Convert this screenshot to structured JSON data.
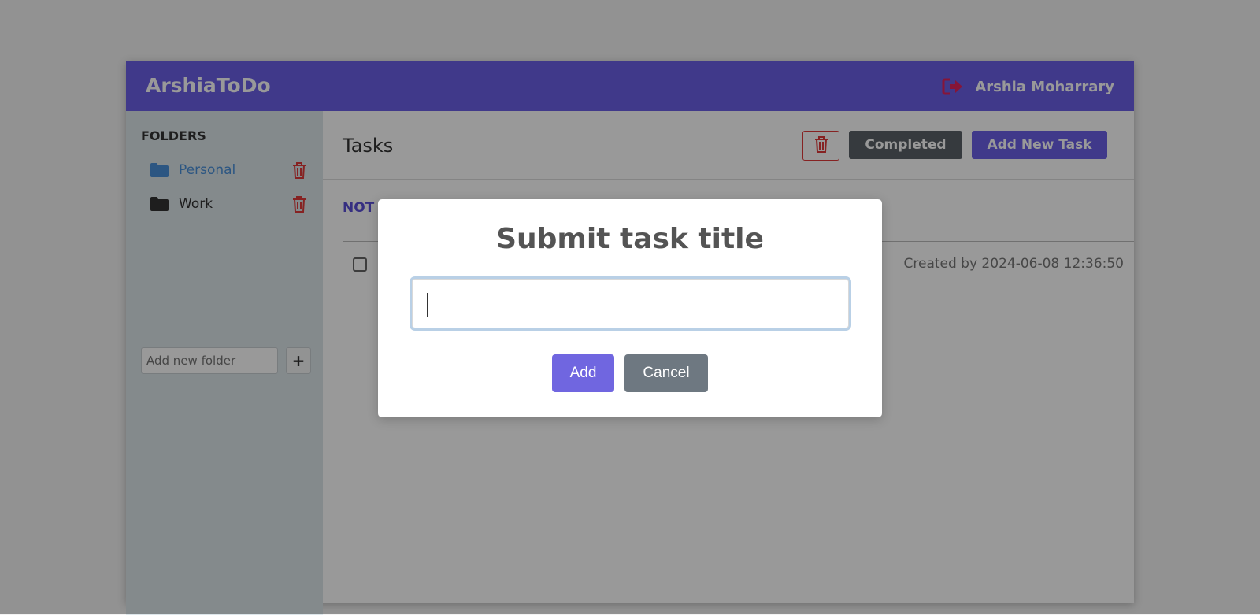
{
  "app": {
    "brand": "ArshiaToDo",
    "user_name": "Arshia Moharrary",
    "icons": {
      "logout": "logout-icon"
    },
    "colors": {
      "primary": "#6c5fe6",
      "danger": "#e03a3a",
      "folder_active": "#4a90d9"
    }
  },
  "sidebar": {
    "heading": "FOLDERS",
    "folders": [
      {
        "label": "Personal",
        "active": true,
        "icon": "folder-icon"
      },
      {
        "label": "Work",
        "active": false,
        "icon": "folder-icon"
      }
    ],
    "add_folder_placeholder": "Add new folder",
    "add_folder_button": "+"
  },
  "main": {
    "title": "Tasks",
    "completed_label": "Completed",
    "add_task_label": "Add New Task",
    "section_label": "NOT C",
    "tasks": [
      {
        "created": "Created by 2024-06-08 12:36:50",
        "checked": false
      }
    ]
  },
  "modal": {
    "title": "Submit task title",
    "input_value": "",
    "add_label": "Add",
    "cancel_label": "Cancel"
  }
}
